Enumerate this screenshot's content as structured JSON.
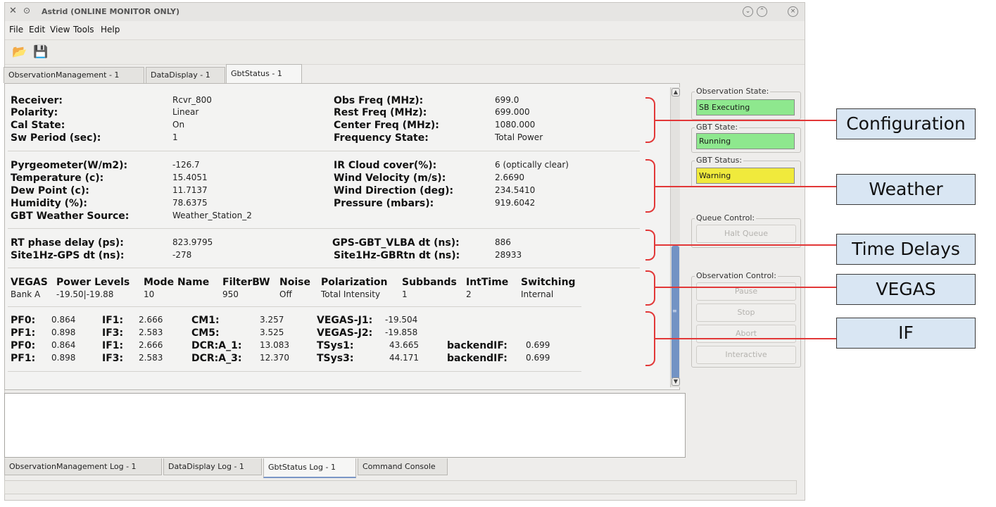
{
  "window": {
    "title": "Astrid (ONLINE MONITOR ONLY)",
    "app_icon": "tools-icon",
    "buttons": [
      "minimize-icon",
      "maximize-icon",
      "close-icon"
    ]
  },
  "menu": [
    "File",
    "Edit",
    "View",
    "Tools",
    "Help"
  ],
  "toolbar": {
    "open_icon": "📂",
    "save_icon": "💾"
  },
  "tabs": [
    "ObservationManagement - 1",
    "DataDisplay - 1",
    "GbtStatus - 1"
  ],
  "config": {
    "left": [
      {
        "label": "Receiver:",
        "value": "Rcvr_800"
      },
      {
        "label": "Polarity:",
        "value": "Linear"
      },
      {
        "label": "Cal State:",
        "value": "On"
      },
      {
        "label": "Sw Period (sec):",
        "value": "1"
      }
    ],
    "right": [
      {
        "label": "Obs Freq (MHz):",
        "value": "699.0"
      },
      {
        "label": "Rest Freq (MHz):",
        "value": "699.000"
      },
      {
        "label": "Center Freq (MHz):",
        "value": "1080.000"
      },
      {
        "label": "Frequency State:",
        "value": "Total Power"
      }
    ]
  },
  "weather": {
    "left": [
      {
        "label": "Pyrgeometer(W/m2):",
        "value": "-126.7"
      },
      {
        "label": "Temperature (c):",
        "value": "15.4051"
      },
      {
        "label": "Dew Point (c):",
        "value": "11.7137"
      },
      {
        "label": "Humidity (%):",
        "value": "78.6375"
      },
      {
        "label": "GBT Weather Source:",
        "value": "Weather_Station_2"
      }
    ],
    "right": [
      {
        "label": "IR Cloud cover(%):",
        "value": "6 (optically clear)"
      },
      {
        "label": "Wind Velocity (m/s):",
        "value": "2.6690"
      },
      {
        "label": "Wind Direction (deg):",
        "value": "234.5410"
      },
      {
        "label": "Pressure (mbars):",
        "value": "919.6042"
      }
    ]
  },
  "delays": {
    "left": [
      {
        "label": "RT phase delay (ps):",
        "value": "823.9795"
      },
      {
        "label": "Site1Hz-GPS dt (ns):",
        "value": "-278"
      }
    ],
    "right": [
      {
        "label": "GPS-GBT_VLBA dt (ns):",
        "value": "886"
      },
      {
        "label": "Site1Hz-GBRtn dt (ns):",
        "value": "28933"
      }
    ]
  },
  "vegas": {
    "headers": [
      "VEGAS",
      "Power Levels",
      "Mode Name",
      "FilterBW",
      "Noise",
      "Polarization",
      "Subbands",
      "IntTime",
      "Switching"
    ],
    "row": [
      "Bank A",
      "-19.50|-19.88",
      "10",
      "950",
      "Off",
      "Total Intensity",
      "1",
      "2",
      "Internal"
    ]
  },
  "if_levels": {
    "rows": [
      [
        [
          "PF0:",
          "0.864"
        ],
        [
          "IF1:",
          "2.666"
        ],
        [
          "CM1:",
          "3.257"
        ],
        [
          "VEGAS-J1:",
          "-19.504"
        ]
      ],
      [
        [
          "PF1:",
          "0.898"
        ],
        [
          "IF3:",
          "2.583"
        ],
        [
          "CM5:",
          "3.525"
        ],
        [
          "VEGAS-J2:",
          "-19.858"
        ]
      ],
      [
        [
          "PF0:",
          "0.864"
        ],
        [
          "IF1:",
          "2.666"
        ],
        [
          "DCR:A_1:",
          "13.083"
        ],
        [
          "TSys1:",
          "43.665"
        ],
        [
          "backendIF:",
          "0.699"
        ]
      ],
      [
        [
          "PF1:",
          "0.898"
        ],
        [
          "IF3:",
          "2.583"
        ],
        [
          "DCR:A_3:",
          "12.370"
        ],
        [
          "TSys3:",
          "44.171"
        ],
        [
          "backendIF:",
          "0.699"
        ]
      ]
    ]
  },
  "side": {
    "obs_state": {
      "title": "Observation State:",
      "value": "SB Executing",
      "color": "#8ee88e"
    },
    "gbt_state": {
      "title": "GBT State:",
      "value": "Running",
      "color": "#8ee88e"
    },
    "gbt_status": {
      "title": "GBT Status:",
      "value": "Warning",
      "color": "#f0ea3c"
    },
    "queue_control": {
      "title": "Queue Control:",
      "button": "Halt Queue"
    },
    "observation_control": {
      "title": "Observation Control:",
      "buttons": [
        "Pause",
        "Stop",
        "Abort",
        "Interactive"
      ]
    }
  },
  "log_tabs": [
    "ObservationManagement Log - 1",
    "DataDisplay Log - 1",
    "GbtStatus Log - 1",
    "Command Console"
  ],
  "callouts": [
    "Configuration",
    "Weather",
    "Time Delays",
    "VEGAS",
    "IF"
  ],
  "annotation_color": "#e23838"
}
